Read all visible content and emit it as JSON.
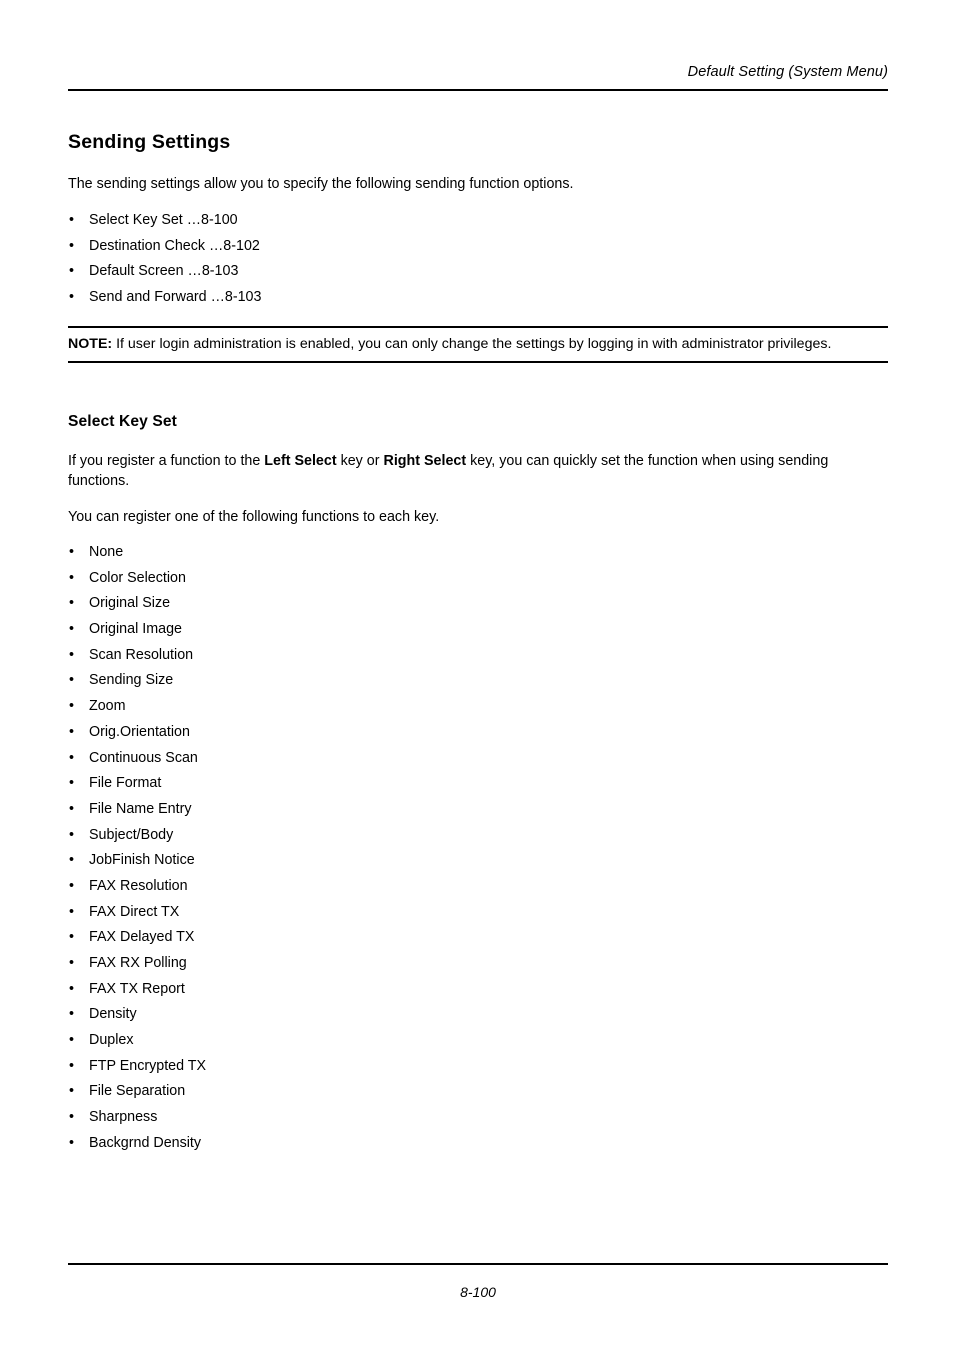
{
  "header": {
    "running_title": "Default Setting (System Menu)"
  },
  "main": {
    "title": "Sending Settings",
    "intro": "The sending settings allow you to specify the following sending function options.",
    "toc_bullets": [
      "Select Key Set …8-100",
      "Destination Check …8-102",
      "Default Screen …8-103",
      "Send and Forward …8-103"
    ],
    "note": {
      "label": "NOTE:",
      "text": "If user login administration is enabled, you can only change the settings by logging in with administrator privileges."
    },
    "section": {
      "title": "Select Key Set",
      "para_a_part1": "If you register a function to the ",
      "para_a_bold1": "Left Select",
      "para_a_part2": " key or ",
      "para_a_bold2": "Right Select",
      "para_a_part3": " key, you can quickly set the function when using sending functions.",
      "para_b": "You can register one of the following functions to each key.",
      "function_bullets": [
        "None",
        "Color Selection",
        "Original Size",
        "Original Image",
        "Scan Resolution",
        "Sending Size",
        "Zoom",
        "Orig.Orientation",
        "Continuous Scan",
        "File Format",
        "File Name Entry",
        "Subject/Body",
        "JobFinish Notice",
        "FAX Resolution",
        "FAX Direct TX",
        "FAX Delayed TX",
        "FAX RX Polling",
        "FAX TX Report",
        "Density",
        "Duplex",
        "FTP Encrypted TX",
        "File Separation",
        "Sharpness",
        "Backgrnd Density"
      ]
    }
  },
  "footer": {
    "page_number": "8-100"
  },
  "bullet_glyph": "•"
}
